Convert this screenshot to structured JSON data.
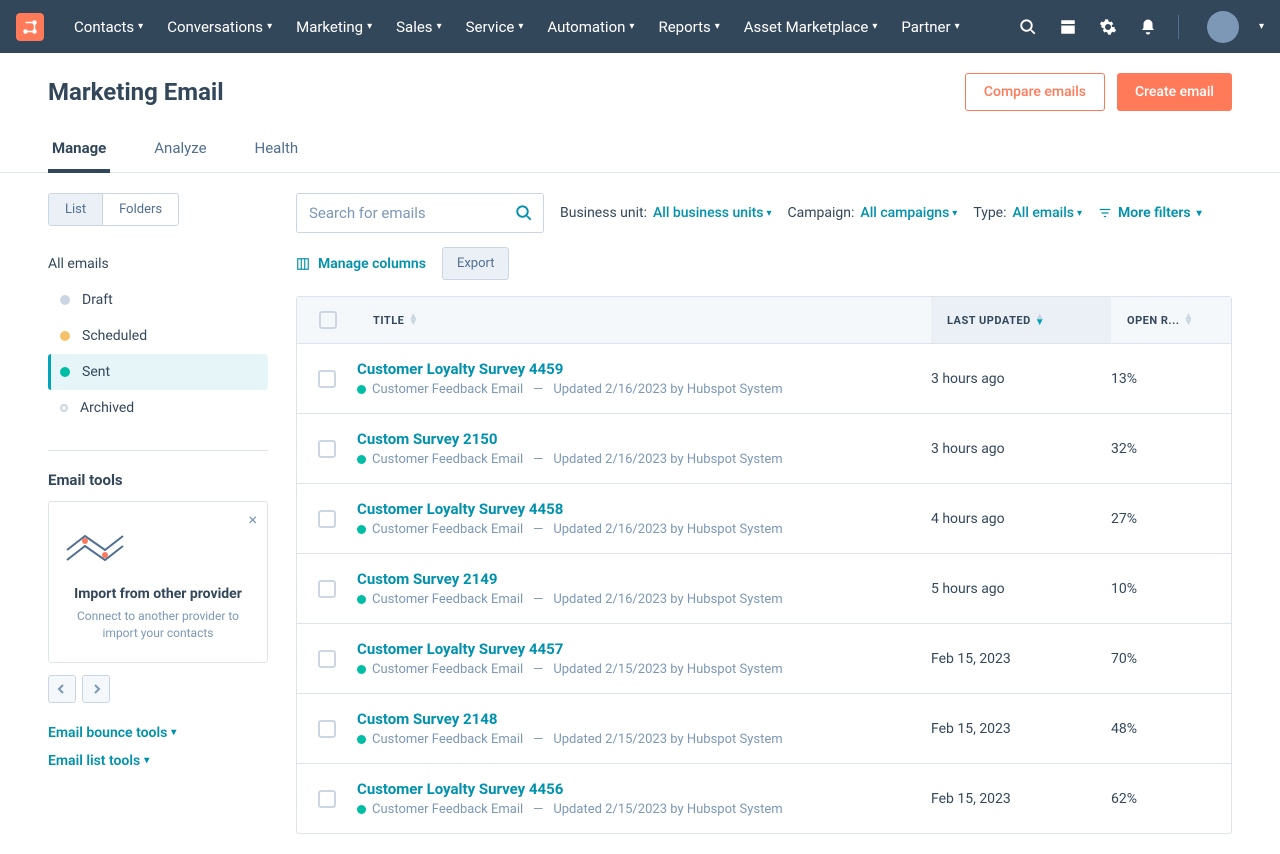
{
  "nav": {
    "items": [
      "Contacts",
      "Conversations",
      "Marketing",
      "Sales",
      "Service",
      "Automation",
      "Reports",
      "Asset Marketplace",
      "Partner"
    ]
  },
  "page": {
    "title": "Marketing Email",
    "compare_btn": "Compare emails",
    "create_btn": "Create email"
  },
  "tabs": [
    "Manage",
    "Analyze",
    "Health"
  ],
  "seg": {
    "list": "List",
    "folders": "Folders"
  },
  "statuses": {
    "all": "All emails",
    "draft": "Draft",
    "scheduled": "Scheduled",
    "sent": "Sent",
    "archived": "Archived"
  },
  "tools": {
    "title": "Email tools",
    "card_title": "Import from other provider",
    "card_desc": "Connect to another provider to import your contacts",
    "bounce": "Email bounce tools",
    "list": "Email list tools"
  },
  "search": {
    "placeholder": "Search for emails"
  },
  "filters": {
    "bu_label": "Business unit:",
    "bu_value": "All business units",
    "campaign_label": "Campaign:",
    "campaign_value": "All campaigns",
    "type_label": "Type:",
    "type_value": "All emails",
    "more": "More filters"
  },
  "actions": {
    "manage_cols": "Manage columns",
    "export": "Export"
  },
  "columns": {
    "title": "TITLE",
    "updated": "LAST UPDATED",
    "open": "OPEN R..."
  },
  "rows": [
    {
      "title": "Customer Loyalty Survey 4459",
      "status": "Customer Feedback Email",
      "updated_meta": "Updated 2/16/2023 by Hubspot System",
      "updated": "3 hours ago",
      "open": "13%"
    },
    {
      "title": "Custom Survey 2150",
      "status": "Customer Feedback Email",
      "updated_meta": "Updated 2/16/2023 by Hubspot System",
      "updated": "3 hours ago",
      "open": "32%"
    },
    {
      "title": "Customer Loyalty Survey 4458",
      "status": "Customer Feedback Email",
      "updated_meta": "Updated 2/16/2023 by Hubspot System",
      "updated": "4 hours ago",
      "open": "27%"
    },
    {
      "title": "Custom Survey 2149",
      "status": "Customer Feedback Email",
      "updated_meta": "Updated 2/16/2023 by Hubspot System",
      "updated": "5 hours ago",
      "open": "10%"
    },
    {
      "title": "Customer Loyalty Survey 4457",
      "status": "Customer Feedback Email",
      "updated_meta": "Updated 2/15/2023 by Hubspot System",
      "updated": "Feb 15, 2023",
      "open": "70%"
    },
    {
      "title": "Custom Survey 2148",
      "status": "Customer Feedback Email",
      "updated_meta": "Updated 2/15/2023 by Hubspot System",
      "updated": "Feb 15, 2023",
      "open": "48%"
    },
    {
      "title": "Customer Loyalty Survey 4456",
      "status": "Customer Feedback Email",
      "updated_meta": "Updated 2/15/2023 by Hubspot System",
      "updated": "Feb 15, 2023",
      "open": "62%"
    }
  ]
}
